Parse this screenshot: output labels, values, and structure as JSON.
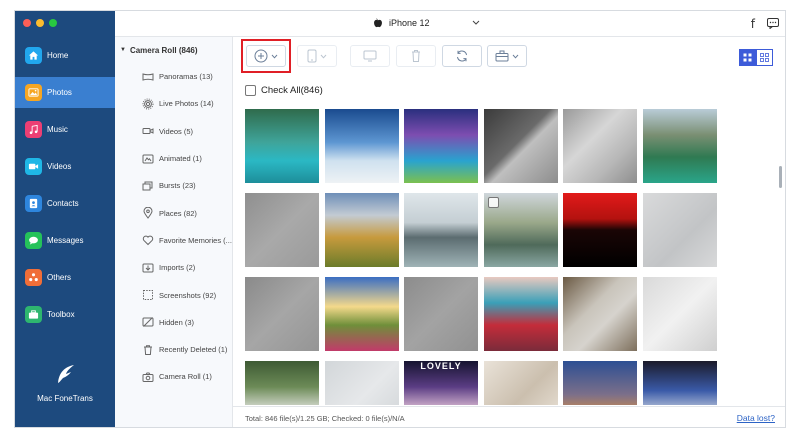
{
  "device": {
    "name": "iPhone 12"
  },
  "nav": {
    "items": [
      {
        "key": "home",
        "label": "Home",
        "color": "#21a7ee"
      },
      {
        "key": "photos",
        "label": "Photos",
        "color": "#f6a623"
      },
      {
        "key": "music",
        "label": "Music",
        "color": "#ec3f74"
      },
      {
        "key": "videos",
        "label": "Videos",
        "color": "#1fb7e6"
      },
      {
        "key": "contacts",
        "label": "Contacts",
        "color": "#2e86de"
      },
      {
        "key": "messages",
        "label": "Messages",
        "color": "#25c25a"
      },
      {
        "key": "others",
        "label": "Others",
        "color": "#f06e38"
      },
      {
        "key": "toolbox",
        "label": "Toolbox",
        "color": "#2eb66f"
      }
    ],
    "active": "photos",
    "brand": "Mac FoneTrans"
  },
  "albums": {
    "root": "Camera Roll (846)",
    "items": [
      {
        "label": "Panoramas (13)",
        "icon": "panorama-icon"
      },
      {
        "label": "Live Photos (14)",
        "icon": "live-photo-icon"
      },
      {
        "label": "Videos (5)",
        "icon": "video-camera-icon"
      },
      {
        "label": "Animated (1)",
        "icon": "gif-icon"
      },
      {
        "label": "Bursts (23)",
        "icon": "burst-icon"
      },
      {
        "label": "Places (82)",
        "icon": "location-pin-icon"
      },
      {
        "label": "Favorite Memories (...",
        "icon": "heart-icon"
      },
      {
        "label": "Imports (2)",
        "icon": "import-icon"
      },
      {
        "label": "Screenshots (92)",
        "icon": "screenshot-icon"
      },
      {
        "label": "Hidden (3)",
        "icon": "hidden-icon"
      },
      {
        "label": "Recently Deleted (1)",
        "icon": "trash-icon"
      },
      {
        "label": "Camera Roll (1)",
        "icon": "camera-icon"
      }
    ]
  },
  "toolbar": {
    "buttons": [
      "add-button",
      "export-to-device-button",
      "export-to-pc-button",
      "delete-button",
      "sync-button",
      "toolbox-button"
    ],
    "view_modes": [
      "grid-view",
      "list-view"
    ]
  },
  "check_all_label": "Check All(846)",
  "photos": [
    {
      "bg": "linear-gradient(180deg,#2f6b4c 0%,#3fa49a 45%,#2bb8c4 70%,#1d8e9a 100%)"
    },
    {
      "bg": "linear-gradient(180deg,#1a4b8f 0%,#5d96d2 45%,#cfe1ef 70%,#eef2f5 100%)"
    },
    {
      "bg": "linear-gradient(180deg,#2a2f7e 0%,#7d4db0 35%,#29a3cf 70%,#7cc04f 100%)"
    },
    {
      "bg": "linear-gradient(135deg,#3b3b3b 0%,#6a6a6a 45%,#bfbfbf 55%,#8d8d8d 100%)"
    },
    {
      "bg": "linear-gradient(135deg,#9a9a9a 0%,#d6d6d6 40%,#b7b7b7 70%,#8e8e8e 100%)"
    },
    {
      "bg": "linear-gradient(180deg,#b9ccd8 0%,#7a8f73 35%,#2f7a52 65%,#2aa58a 100%)"
    },
    {
      "bg": "linear-gradient(135deg,#8f8f8f 0%,#a9a9a9 50%,#9a9a9a 100%)"
    },
    {
      "bg": "linear-gradient(180deg,#6e8fb8 0%,#c3cbd3 30%,#c79a3d 60%,#6b7c2a 100%)"
    },
    {
      "bg": "linear-gradient(180deg,#dfe6ea 0%,#c4ced3 40%,#5b6c70 60%,#9fb3b6 100%)"
    },
    {
      "bg": "linear-gradient(180deg,#cfd6db 0%,#9aa88a 40%,#4f6a5a 70%,#8aa7a3 100%)",
      "checkbox": true
    },
    {
      "bg": "linear-gradient(180deg,#e21a1a 0%,#b3120f 35%,#1a0505 50%,#000000 100%)"
    },
    {
      "bg": "linear-gradient(135deg,#d9dadb 0%,#c2c4c6 60%,#d8d9da 100%)"
    },
    {
      "bg": "linear-gradient(135deg,#8a8a8a 0%,#a6a6a6 50%,#959595 100%)"
    },
    {
      "bg": "linear-gradient(180deg,#3b6ec2 0%,#f4d98b 40%,#6f8f3a 65%,#c23a6a 100%)"
    },
    {
      "bg": "linear-gradient(135deg,#8c8c8c 0%,#a3a3a3 50%,#919191 100%)"
    },
    {
      "bg": "linear-gradient(180deg,#e8c9c0 0%,#3aa0b8 35%,#c42c3a 65%,#7a2b3a 100%)"
    },
    {
      "bg": "linear-gradient(135deg,#6b5a44 0%,#c9c4bb 40%,#d6d3cd 60%,#7d6f5c 100%)"
    },
    {
      "bg": "linear-gradient(135deg,#d9d9d9 0%,#f1f1f1 50%,#cfcfcf 100%)"
    },
    {
      "bg": "linear-gradient(180deg,#3e5a34 0%,#6c8b57 35%,#d8dcd3 65%,#8aa2a0 100%)"
    },
    {
      "bg": "linear-gradient(135deg,#d2d6d9 0%,#e6e8ea 50%,#cdd1d4 100%)"
    },
    {
      "bg": "linear-gradient(180deg,#161430 0%,#5b3d84 35%,#d9b9d2 65%,#20203a 100%)",
      "caption": "LOVELY"
    },
    {
      "bg": "linear-gradient(135deg,#e9e2d8 0%,#cbbfae 50%,#efe9e0 100%)"
    },
    {
      "bg": "linear-gradient(180deg,#2d4f93 0%,#7b6f8a 45%,#c88a52 70%,#5d4b3b 100%)"
    },
    {
      "bg": "linear-gradient(180deg,#1b1b2a 0%,#3a5aa8 40%,#c8d0e0 70%,#3c2f2f 100%)"
    }
  ],
  "status": {
    "summary": "Total: 846 file(s)/1.25 GB; Checked: 0 file(s)/N/A",
    "data_lost": "Data lost?"
  }
}
